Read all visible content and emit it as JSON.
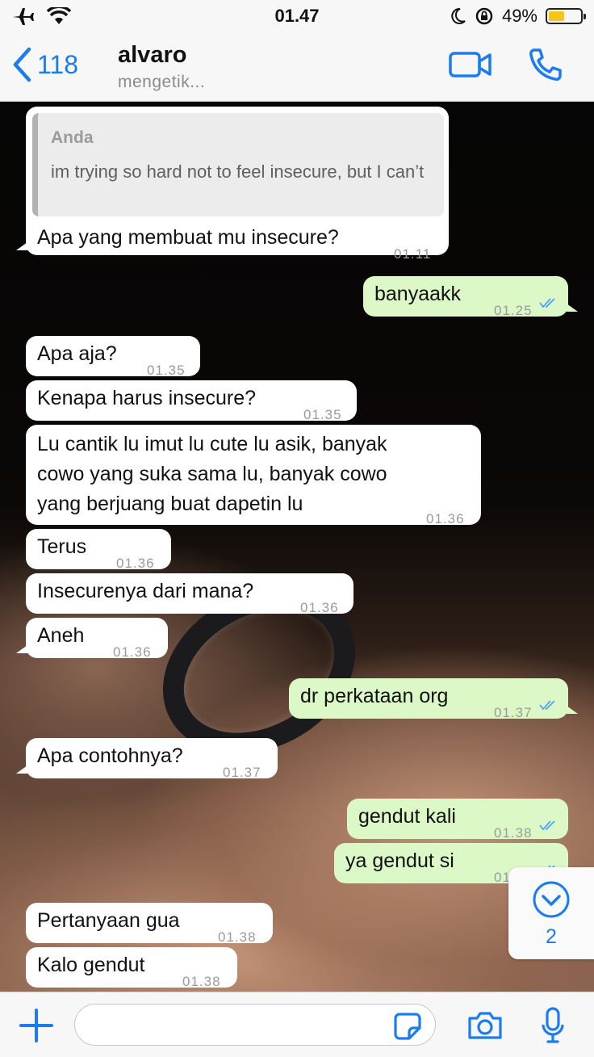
{
  "status_bar": {
    "time": "01.47",
    "battery_percent": "49%",
    "battery_level": 0.49,
    "battery_color": "#f5c518"
  },
  "nav": {
    "back_count": "118",
    "contact_name": "alvaro",
    "contact_status": "mengetik..."
  },
  "messages": [
    {
      "dir": "in",
      "quote_author": "Anda",
      "quote_text": "im trying so hard not to feel insecure, but I can’t",
      "text": "Apa yang membuat mu insecure?",
      "time": "01.11"
    },
    {
      "dir": "out",
      "text": "banyaakk",
      "time": "01.25",
      "read": true
    },
    {
      "dir": "in",
      "text": "Apa aja?",
      "time": "01.35"
    },
    {
      "dir": "in",
      "text": "Kenapa harus insecure?",
      "time": "01.35"
    },
    {
      "dir": "in",
      "lines": [
        "Lu cantik lu imut lu cute lu asik, banyak",
        "cowo yang suka sama lu, banyak cowo",
        "yang berjuang buat dapetin lu"
      ],
      "time": "01.36"
    },
    {
      "dir": "in",
      "text": "Terus",
      "time": "01.36"
    },
    {
      "dir": "in",
      "text": "Insecurenya dari mana?",
      "time": "01.36"
    },
    {
      "dir": "in",
      "text": "Aneh",
      "time": "01.36"
    },
    {
      "dir": "out",
      "text": "dr perkataan org",
      "time": "01.37",
      "read": true
    },
    {
      "dir": "in",
      "text": "Apa contohnya?",
      "time": "01.37"
    },
    {
      "dir": "out",
      "text": "gendut kali",
      "time": "01.38",
      "read": true
    },
    {
      "dir": "out",
      "text": "ya gendut si",
      "time": "01.38",
      "read": true
    },
    {
      "dir": "in",
      "text": "Pertanyaan gua",
      "time": "01.38"
    },
    {
      "dir": "in",
      "text": "Kalo gendut",
      "time": "01.38"
    }
  ],
  "scroll_down": {
    "unread_count": "2"
  },
  "input": {
    "placeholder": ""
  },
  "colors": {
    "accent": "#1a7cf0",
    "outgoing_bubble": "#dcf8c6",
    "incoming_bubble": "#ffffff",
    "read_ticks": "#4fa3f7"
  }
}
